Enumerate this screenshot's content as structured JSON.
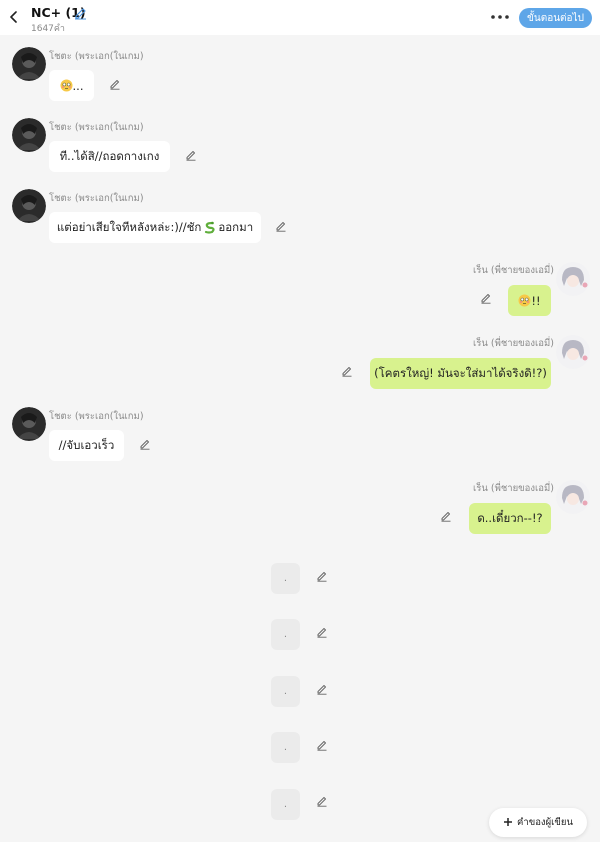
{
  "header": {
    "title": "NC+ (1)",
    "subtitle": "1647คำ",
    "next_label": "ขั้นตอนต่อไป"
  },
  "messages": [
    {
      "side": "left",
      "sender": "โชตะ (พระเอก(ในเกม)",
      "text": "..."
    },
    {
      "side": "left",
      "sender": "โชตะ (พระเอก(ในเกม)",
      "text": "ที..ได้สิ//ถอดกางเกง"
    },
    {
      "side": "left",
      "sender": "โชตะ (พระเอก(ในเกม)",
      "text_before": "แต่อย่าเสียใจทีหลังหล่ะ:)//ชัก",
      "text_after": "ออกมา"
    },
    {
      "side": "right",
      "sender": "เร็น (พี่ชายของเอมี่)",
      "text": "!!"
    },
    {
      "side": "right",
      "sender": "เร็น (พี่ชายของเอมี่)",
      "text": "(โคตรใหญ่! มันจะใส่มาได้จริงดิ!?)"
    },
    {
      "side": "left",
      "sender": "โชตะ (พระเอก(ในเกม)",
      "text": "//จับเอวเร็ว"
    },
    {
      "side": "right",
      "sender": "เร็น (พี่ชายของเอมี่)",
      "text": "ด..เดี๋ยวก--!?"
    },
    {
      "side": "center",
      "text": "."
    },
    {
      "side": "center",
      "text": "."
    },
    {
      "side": "center",
      "text": "."
    },
    {
      "side": "center",
      "text": "."
    },
    {
      "side": "center",
      "text": "."
    }
  ],
  "comment_button": "คำของผู้เขียน",
  "icons": {
    "back": "chevron-left-icon",
    "title_edit": "pencil-icon",
    "more": "more-horizontal-icon",
    "edit": "pencil-icon",
    "plus": "plus-icon",
    "emoji": "flushed-face-icon",
    "snake": "snake-icon"
  },
  "colors": {
    "accent": "#5ea6e8",
    "right_bubble": "#d8f28e",
    "left_bubble": "#ffffff",
    "background": "#f5f5f5"
  }
}
